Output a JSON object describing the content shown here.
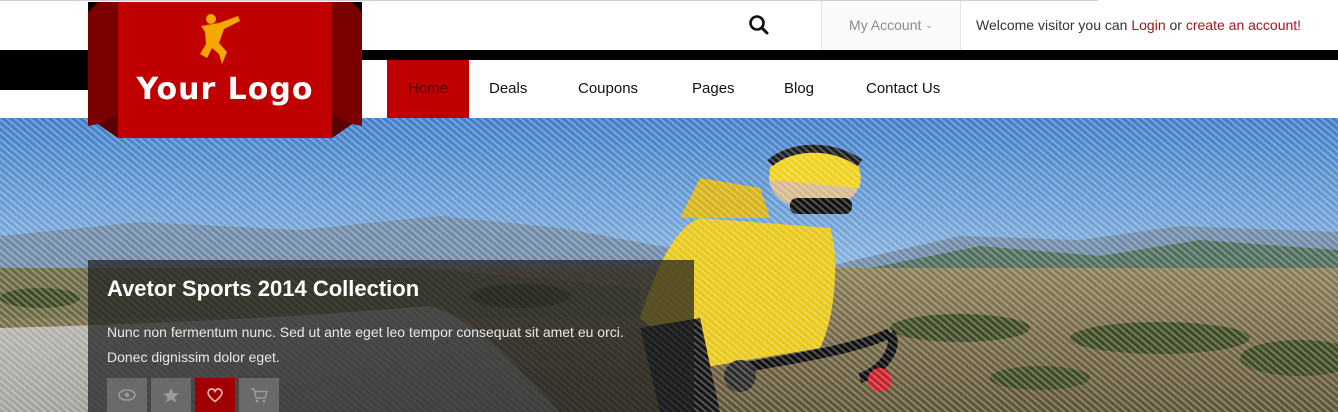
{
  "logo": {
    "text": "Your Logo",
    "brand_color": "#c00000"
  },
  "header": {
    "search_icon": "search-icon",
    "account_label": "My Account",
    "account_chevron": "chevron-down-icon",
    "welcome_text": "Welcome visitor you can",
    "login_link": "Login",
    "or_text": "or",
    "create_link": "create an account!",
    "link_color": "#a1161b"
  },
  "nav": {
    "items": [
      {
        "label": "Home",
        "active": true
      },
      {
        "label": "Deals"
      },
      {
        "label": "Coupons"
      },
      {
        "label": "Pages"
      },
      {
        "label": "Blog"
      },
      {
        "label": "Contact Us"
      }
    ]
  },
  "hero": {
    "title": "Avetor Sports 2014 Collection",
    "description": "Nunc non fermentum nunc. Sed ut ante eget leo tempor consequat sit amet eu orci. Donec dignissim dolor eget.",
    "actions": [
      {
        "icon": "eye-icon"
      },
      {
        "icon": "star-icon"
      },
      {
        "icon": "heart-icon",
        "active": true
      },
      {
        "icon": "cart-icon"
      }
    ]
  }
}
